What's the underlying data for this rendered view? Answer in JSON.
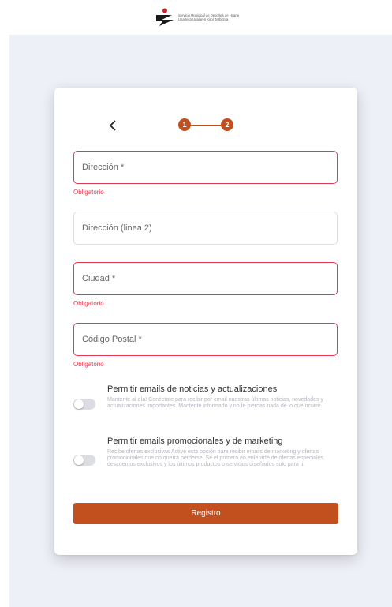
{
  "header": {
    "logo_line1": "Servicio Municipal de Deportes de Huarte",
    "logo_line2": "Uharteko Udalaren Kirol Zerbitzua"
  },
  "stepper": {
    "step1": "1",
    "step2": "2",
    "current_step": 2,
    "total_steps": 2
  },
  "fields": {
    "address": {
      "placeholder": "Dirección *",
      "error": "Obligatorio"
    },
    "address2": {
      "placeholder": "Dirección (linea 2)"
    },
    "city": {
      "placeholder": "Ciudad *",
      "error": "Obligatorio"
    },
    "postal": {
      "placeholder": "Código Postal *",
      "error": "Obligatorio"
    }
  },
  "options": {
    "news": {
      "title": "Permitir emails de noticias y actualizaciones",
      "desc": "Mantente al día! Conéctate para recibir por email nuestras últimas noticias, novedades y actualizaciones importantes. Mantente informado y no te pierdas nada de lo que ocurre.",
      "enabled": false
    },
    "promo": {
      "title": "Permitir emails promocionales y de marketing",
      "desc": "Recibe ofertas exclusivas Active esta opción para recibir emails de marketing y ofertas promocionales que no querrá perderse. Sé el primero en enterarte de ofertas especiales, descuentos exclusivos y los últimos productos o servicios diseñados solo para ti.",
      "enabled": false
    }
  },
  "submit_label": "Registro",
  "colors": {
    "accent": "#c2501f",
    "error": "#e03a52"
  }
}
